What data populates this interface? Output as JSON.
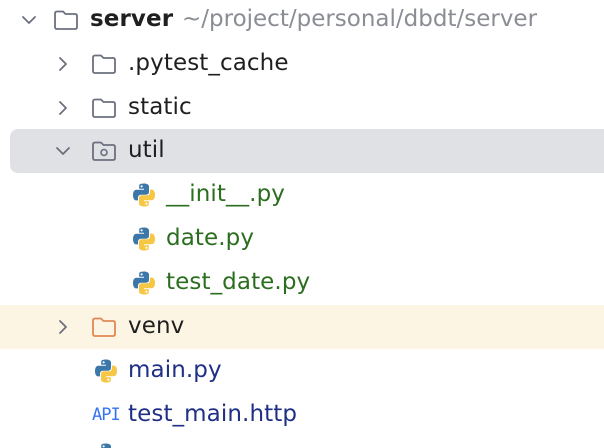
{
  "tree": {
    "root": {
      "name": "server",
      "path": "~/project/personal/dbdt/server",
      "icon": "folder-icon",
      "expanded": true
    },
    "items": [
      {
        "name": ".pytest_cache",
        "icon": "folder-icon",
        "type": "folder",
        "expanded": false
      },
      {
        "name": "static",
        "icon": "folder-icon",
        "type": "folder",
        "expanded": false
      },
      {
        "name": "util",
        "icon": "package-folder-icon",
        "type": "folder",
        "expanded": true,
        "selected": true
      },
      {
        "name": "__init__.py",
        "icon": "python-icon",
        "type": "file"
      },
      {
        "name": "date.py",
        "icon": "python-icon",
        "type": "file"
      },
      {
        "name": "test_date.py",
        "icon": "python-icon",
        "type": "file"
      },
      {
        "name": "venv",
        "icon": "excluded-folder-icon",
        "type": "folder",
        "expanded": false
      },
      {
        "name": "main.py",
        "icon": "python-icon",
        "type": "file"
      },
      {
        "name": "test_main.http",
        "icon": "api-icon",
        "type": "file",
        "icon_text": "API"
      }
    ]
  },
  "colors": {
    "selection_background": "#dfe1e5",
    "excluded_background": "#fdf5e4",
    "modified_file_text": "#2b6e1f",
    "file_text": "#1f2f86",
    "path_text": "#8a8d93",
    "api_icon": "#3574f0",
    "python_blue": "#3b77a8",
    "python_yellow": "#f6c744"
  }
}
